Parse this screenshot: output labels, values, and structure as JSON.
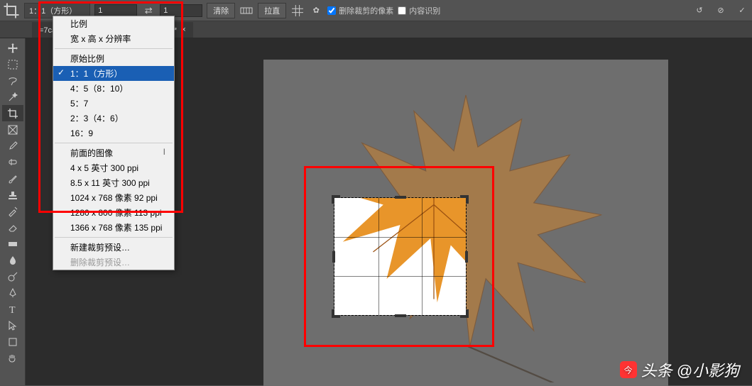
{
  "options_bar": {
    "ratio_label": "1：1（方形）",
    "input1": "1",
    "input2": "1",
    "clear_btn": "清除",
    "straighten_btn": "拉直",
    "checkbox1_label": "删除裁剪的像素",
    "checkbox2_label": "内容识别"
  },
  "tab": {
    "title": "=7ca.jpg @ 100% (裁剪预览, RGB/8#) *"
  },
  "dropdown": {
    "group1_header": "比例",
    "group1_sub": "宽 x 高 x 分辨率",
    "group2_header": "原始比例",
    "ratios": [
      {
        "label": "1：1（方形）",
        "selected": true
      },
      {
        "label": "4：5（8：10）"
      },
      {
        "label": "5：7"
      },
      {
        "label": "2：3（4：6）"
      },
      {
        "label": "16：9"
      }
    ],
    "group3_header": "前面的图像",
    "group3_key": "I",
    "presets": [
      {
        "label": "4 x 5 英寸 300 ppi"
      },
      {
        "label": "8.5 x 11 英寸 300 ppi"
      },
      {
        "label": "1024 x 768 像素 92 ppi"
      },
      {
        "label": "1280 x 800 像素 113 ppi"
      },
      {
        "label": "1366 x 768 像素 135 ppi"
      }
    ],
    "new_preset": "新建裁剪预设…",
    "delete_preset": "删除裁剪预设…"
  },
  "watermark": {
    "brand": "头条",
    "user": "@小影狗"
  }
}
